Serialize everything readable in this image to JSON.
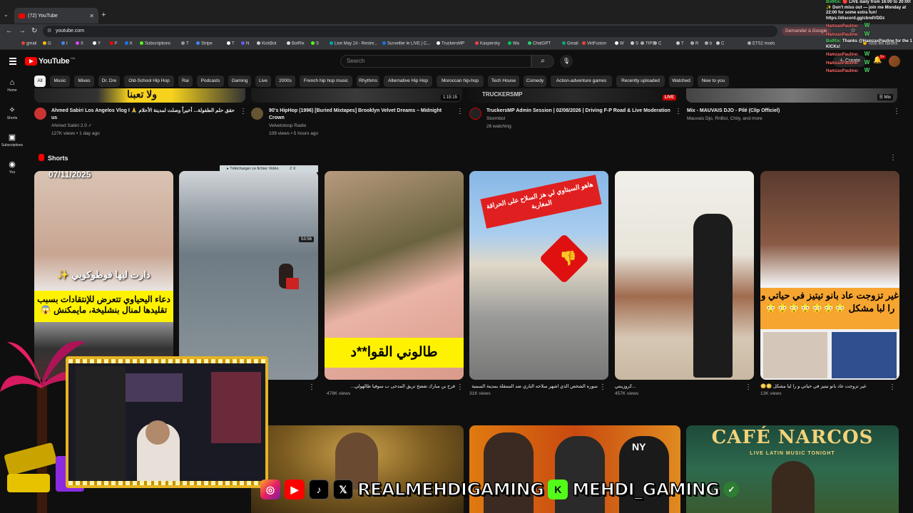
{
  "browser": {
    "tab_title": "(72) YouTube",
    "url": "youtube.com",
    "ask_google": "Demander à Google",
    "demand_overlap": "Demander",
    "bookmarks": [
      "gmail",
      "G",
      "I",
      "X",
      "Y",
      "F",
      "K",
      "Subscriptions",
      "T",
      "Stripe",
      "T",
      "N",
      "KickBot",
      "BotRix",
      "S",
      "Live May 24 - Restre...",
      "Surveiller le LIVE | C...",
      "TruckersMP",
      "Kaspersky",
      "Wa",
      "ChatGPT",
      "Gmail",
      "VirtFusion",
      "W",
      "S",
      "TIPS",
      "C",
      "T",
      "R",
      "b",
      "C",
      "ETS2 mods",
      "Tous les favoris"
    ]
  },
  "youtube": {
    "logo": "YouTube",
    "logo_region": "MA",
    "search_placeholder": "Search",
    "create_label": "Create",
    "notifications": "9+",
    "sidebar": [
      {
        "label": "Home",
        "icon": "home-icon",
        "glyph": "⌂"
      },
      {
        "label": "Shorts",
        "icon": "shorts-icon",
        "glyph": "⟡"
      },
      {
        "label": "Subscriptions",
        "icon": "subscriptions-icon",
        "glyph": "▣"
      },
      {
        "label": "You",
        "icon": "you-icon",
        "glyph": "◉"
      }
    ],
    "chips": [
      "All",
      "Music",
      "Mixes",
      "Dr. Dre",
      "Old-School Hip Hop",
      "Rai",
      "Podcasts",
      "Gaming",
      "Live",
      "2000s",
      "French hip hop music",
      "Rhythms",
      "Alternative Hip Hop",
      "Moroccan hip-hop",
      "Tech House",
      "Comedy",
      "Action-adventure games",
      "Recently uploaded",
      "Watched",
      "New to you"
    ],
    "top_videos": [
      {
        "title": "Ahmed Sabiri Los Angelos Vlog I 🙏 حقق حلم الطفولة... أخيراً وصلت لمدينة الأحلام us",
        "channel": "Ahmed Sabiri 2.0 ✓",
        "stats": "127K views • 1 day ago",
        "duration": "",
        "thumb_text": "ولا تعبنا"
      },
      {
        "title": "90's HipHop (1996) [Buried Mixtapes] Brooklyn Velvet Dreams – Midnight Crown",
        "channel": "Velvetstoop Radio",
        "stats": "109 views • 5 hours ago",
        "duration": "1:15:15"
      },
      {
        "title": "TruckersMP Admin Session | 02/08/2026 | Driving F-P Road & Live Moderation",
        "channel": "Stormbol",
        "stats": "26 watching",
        "live": "LIVE",
        "thumb_text": "TRUCKERSMP"
      },
      {
        "title": "Mix - MAUVAIS DJO - Pilé (Clip Officiel)",
        "channel": "Mauvais Djo, RnBoi, Chily, and more",
        "stats": ""
      }
    ],
    "shorts_header": "Shorts",
    "shorts": [
      {
        "date_overlay": "07/11/2025",
        "caption_white": "دارت ليها فوطوكوبي ✨",
        "caption_yellow": "دعاء اليحياوي تتعرض للإنتقادات بسبب تقليدها لمنال بنشليخة، مايمكنش 😱",
        "title": "",
        "views": ""
      },
      {
        "duration": "53:56",
        "download": "Télécharger ce fichier Vidéo",
        "download_hint": "2 X",
        "title": "",
        "views": ""
      },
      {
        "caption_yellow": "طالوني القوا**د",
        "title": "فرح بن مبارك تفضح تريق المدحى ب سوفيا طالهولي...",
        "views": "478K views"
      },
      {
        "caption_red": "هاهو السبتاوي لي هز السلاح على الحراقة المغاربة",
        "title": "سوره الشخص الذي اشهر سلاحه الناري ضد المتنقلة بمدينة السبتية",
        "views": "31K views"
      },
      {
        "title": "...كروزينتي",
        "views": "457K views"
      },
      {
        "caption_orange": "غير تزوجت عاد بانو تيتيز في حياتي و را لبا مشكل 😳😳😳😳😳😳😳",
        "title": "غير تزوجت عاد بانو تيتيز في حياتي و را ليا مشكل 😳😳",
        "views": "13K views"
      }
    ],
    "bottom_thumbs": [
      {
        "text": ""
      },
      {
        "text": ""
      },
      {
        "text": "NY"
      },
      {
        "title": "CAFÉ NARCOS",
        "subtitle": "LIVE LATIN MUSIC TONIGHT"
      }
    ]
  },
  "stream": {
    "chat": [
      {
        "user": "BotRix:",
        "text": "🔴 LIVE daily from 16:00 to 20:00! ✨ Don't miss out — join me Monday at 22:00 for some extra fun! https://discord.gg/cbndVDDz",
        "color": "green"
      },
      {
        "user": "HamzaxPauline:",
        "text": "W",
        "color": "red"
      },
      {
        "user": "HamzaxPauline:",
        "text": "W",
        "color": "red"
      },
      {
        "user": "BotRix:",
        "text": "Thanks @HamzaxPauline for the 1 KICKs!",
        "color": "green"
      },
      {
        "user": "HamzaxPauline:",
        "text": "W",
        "color": "red"
      },
      {
        "user": "HamzaxPauline:",
        "text": "W",
        "color": "red"
      },
      {
        "user": "HamzaxPauline:",
        "text": "W",
        "color": "red"
      }
    ],
    "handle_1": "REALMEHDIGAMING",
    "handle_2": "MEHDI_GAMING",
    "kick_letter": "K"
  },
  "colors": {
    "yt_red": "#ff0000",
    "bg": "#0f0f0f",
    "chip": "#272727",
    "gold": "#e6b422",
    "kick_green": "#53fc18"
  }
}
